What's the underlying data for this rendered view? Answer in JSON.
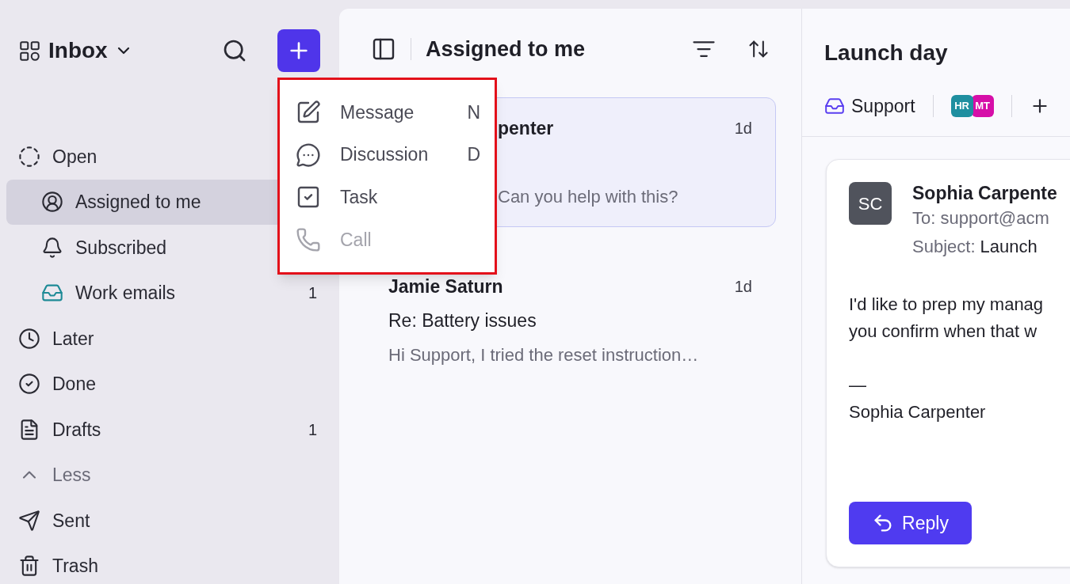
{
  "sidebar": {
    "title": "Inbox",
    "items": [
      {
        "label": "Open",
        "kind": "section",
        "children": [
          {
            "label": "Assigned to me",
            "selected": true
          },
          {
            "label": "Subscribed",
            "selected": false
          },
          {
            "label": "Work emails",
            "selected": false,
            "count": "1"
          }
        ]
      },
      {
        "label": "Later",
        "kind": "item",
        "selected": false
      },
      {
        "label": "Done",
        "kind": "item",
        "selected": false
      },
      {
        "label": "Drafts",
        "kind": "item",
        "selected": false,
        "count": "1"
      },
      {
        "label": "Less",
        "kind": "toggle"
      },
      {
        "label": "Sent",
        "kind": "item",
        "selected": false
      },
      {
        "label": "Trash",
        "kind": "item",
        "selected": false
      }
    ]
  },
  "new_menu": {
    "items": [
      {
        "label": "Message",
        "shortcut": "N",
        "disabled": false
      },
      {
        "label": "Discussion",
        "shortcut": "D",
        "disabled": false
      },
      {
        "label": "Task",
        "disabled": false
      },
      {
        "label": "Call",
        "disabled": true
      }
    ]
  },
  "list": {
    "title": "Assigned to me",
    "rows": [
      {
        "sender": "penter",
        "time": "1d",
        "preview": "Can you help with this?",
        "selected": true,
        "partly_covered": true
      },
      {
        "sender": "Jamie Saturn",
        "time": "1d",
        "subject": "Re: Battery issues",
        "preview": "Hi Support, I tried the reset instruction…",
        "selected": false,
        "partly_covered": false
      }
    ]
  },
  "detail": {
    "title": "Launch day",
    "inbox": "Support",
    "assignees": [
      {
        "initials": "HR",
        "color": "#1f8fa0"
      },
      {
        "initials": "MT",
        "color": "#d60fa8"
      }
    ],
    "message": {
      "avatar": "SC",
      "sender": "Sophia Carpente",
      "to": "To: support@acm",
      "subject_label": "Subject:",
      "subject": "Launch",
      "body": [
        "I'd like to prep my manag",
        "you confirm when that w"
      ],
      "signature": [
        "—",
        "Sophia Carpenter"
      ]
    },
    "reply": "Reply"
  }
}
